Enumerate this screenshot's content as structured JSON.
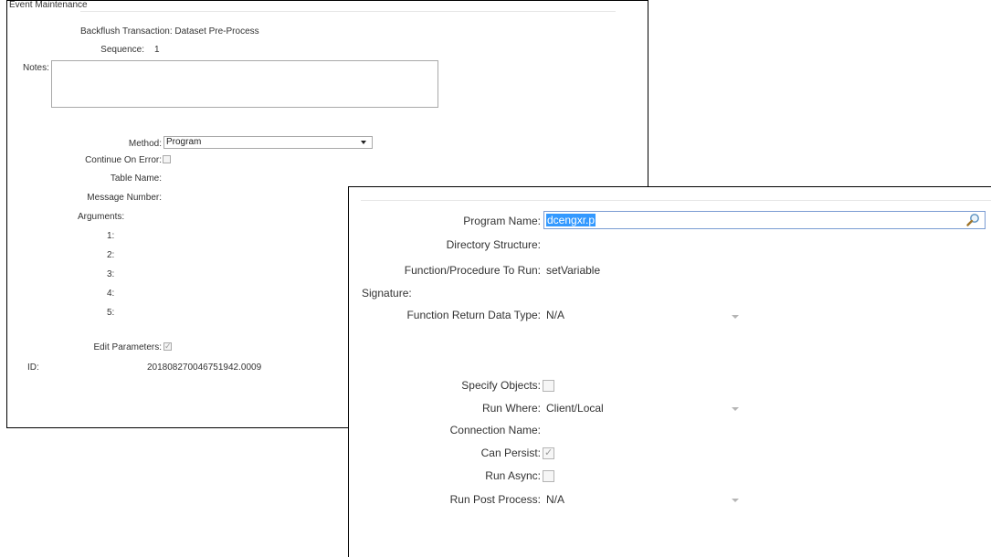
{
  "back_panel": {
    "title": "Event Maintenance",
    "header": "Backflush Transaction: Dataset Pre-Process",
    "sequence_label": "Sequence:",
    "sequence_value": "1",
    "notes_label": "Notes:",
    "notes_value": "",
    "method_label": "Method:",
    "method_value": "Program",
    "continue_on_error_label": "Continue On Error:",
    "continue_on_error_checked": false,
    "table_name_label": "Table Name:",
    "message_number_label": "Message Number:",
    "arguments_label": "Arguments:",
    "argument_labels": [
      "1:",
      "2:",
      "3:",
      "4:",
      "5:"
    ],
    "edit_parameters_label": "Edit Parameters:",
    "edit_parameters_checked": true,
    "id_label": "ID:",
    "id_value": "201808270046751942.0009"
  },
  "front_panel": {
    "program_name_label": "Program Name:",
    "program_name_value": "dcengxr.p",
    "directory_structure_label": "Directory Structure:",
    "function_label": "Function/Procedure To Run:",
    "function_value": "setVariable",
    "signature_label": "Signature:",
    "return_type_label": "Function Return Data Type:",
    "return_type_value": "N/A",
    "specify_objects_label": "Specify Objects:",
    "specify_objects_checked": false,
    "run_where_label": "Run Where:",
    "run_where_value": "Client/Local",
    "connection_name_label": "Connection Name:",
    "can_persist_label": "Can Persist:",
    "can_persist_checked": true,
    "run_async_label": "Run Async:",
    "run_async_checked": false,
    "run_post_process_label": "Run Post Process:",
    "run_post_process_value": "N/A"
  },
  "icons": {
    "search": "magnifier-icon",
    "dropdown": "chevron-down-icon",
    "checkmark": "✓"
  },
  "colors": {
    "selection": "#3399ff",
    "border": "#000000",
    "field_border": "#a9a9a9",
    "disabled_arrow": "#b5b5b5"
  }
}
